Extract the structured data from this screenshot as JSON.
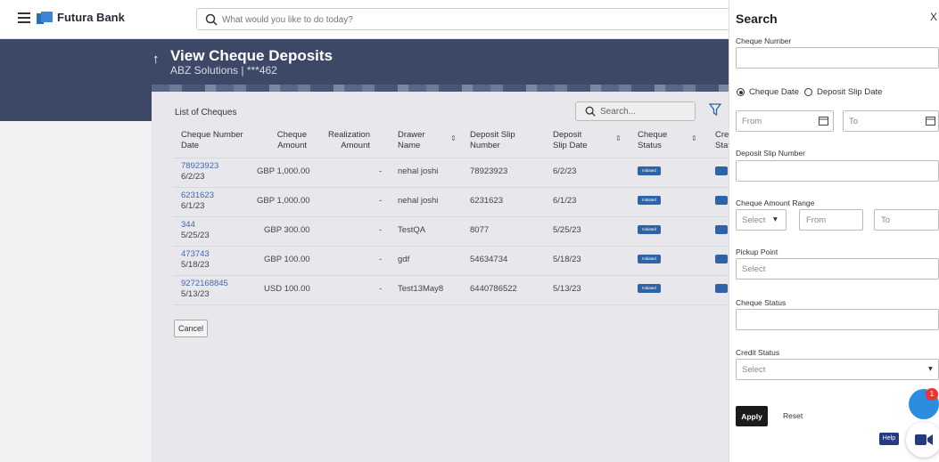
{
  "topbar": {
    "brand": "Futura Bank",
    "search_placeholder": "What would you like to do today?"
  },
  "page": {
    "title": "View Cheque Deposits",
    "subtitle": "ABZ Solutions | ***462"
  },
  "list": {
    "title": "List of Cheques",
    "search_placeholder": "Search...",
    "columns": {
      "cheque_number_date": "Cheque Number Date",
      "cheque_amount": "Cheque Amount",
      "realization_amount": "Realization Amount",
      "drawer_name": "Drawer Name",
      "deposit_slip_number": "Deposit Slip Number",
      "deposit_slip_date": "Deposit Slip Date",
      "cheque_status": "Cheque Status",
      "credit_status": "Cred Stat"
    },
    "rows": [
      {
        "number": "78923923",
        "date": "6/2/23",
        "amount": "GBP 1,000.00",
        "realization": "-",
        "drawer": "nehal joshi",
        "slip_number": "78923923",
        "slip_date": "6/2/23",
        "status": "Initiated"
      },
      {
        "number": "6231623",
        "date": "6/1/23",
        "amount": "GBP 1,000.00",
        "realization": "-",
        "drawer": "nehal joshi",
        "slip_number": "6231623",
        "slip_date": "6/1/23",
        "status": "Initiated"
      },
      {
        "number": "344",
        "date": "5/25/23",
        "amount": "GBP 300.00",
        "realization": "-",
        "drawer": "TestQA",
        "slip_number": "8077",
        "slip_date": "5/25/23",
        "status": "Initiated"
      },
      {
        "number": "473743",
        "date": "5/18/23",
        "amount": "GBP 100.00",
        "realization": "-",
        "drawer": "gdf",
        "slip_number": "54634734",
        "slip_date": "5/18/23",
        "status": "Initiated"
      },
      {
        "number": "9272168845",
        "date": "5/13/23",
        "amount": "USD 100.00",
        "realization": "-",
        "drawer": "Test13May8",
        "slip_number": "6440786522",
        "slip_date": "5/13/23",
        "status": "Initiated"
      }
    ],
    "cancel_label": "Cancel"
  },
  "search_panel": {
    "title": "Search",
    "close": "X",
    "cheque_number_label": "Cheque Number",
    "radio_cheque_date": "Cheque Date",
    "radio_deposit_slip_date": "Deposit Slip Date",
    "from_placeholder": "From",
    "to_placeholder": "To",
    "deposit_slip_number_label": "Deposit Slip Number",
    "amount_range_label": "Cheque Amount Range",
    "select_placeholder": "Select",
    "pickup_point_label": "Pickup Point",
    "cheque_status_label": "Cheque Status",
    "credit_status_label": "Credit Status",
    "apply_label": "Apply",
    "reset_label": "Reset"
  },
  "widgets": {
    "chat_badge": "1",
    "help_label": "Help"
  },
  "colors": {
    "header": "#3d4866",
    "badge": "#2f63a8",
    "link": "#3f6ab0",
    "chat": "#2a8de0"
  }
}
